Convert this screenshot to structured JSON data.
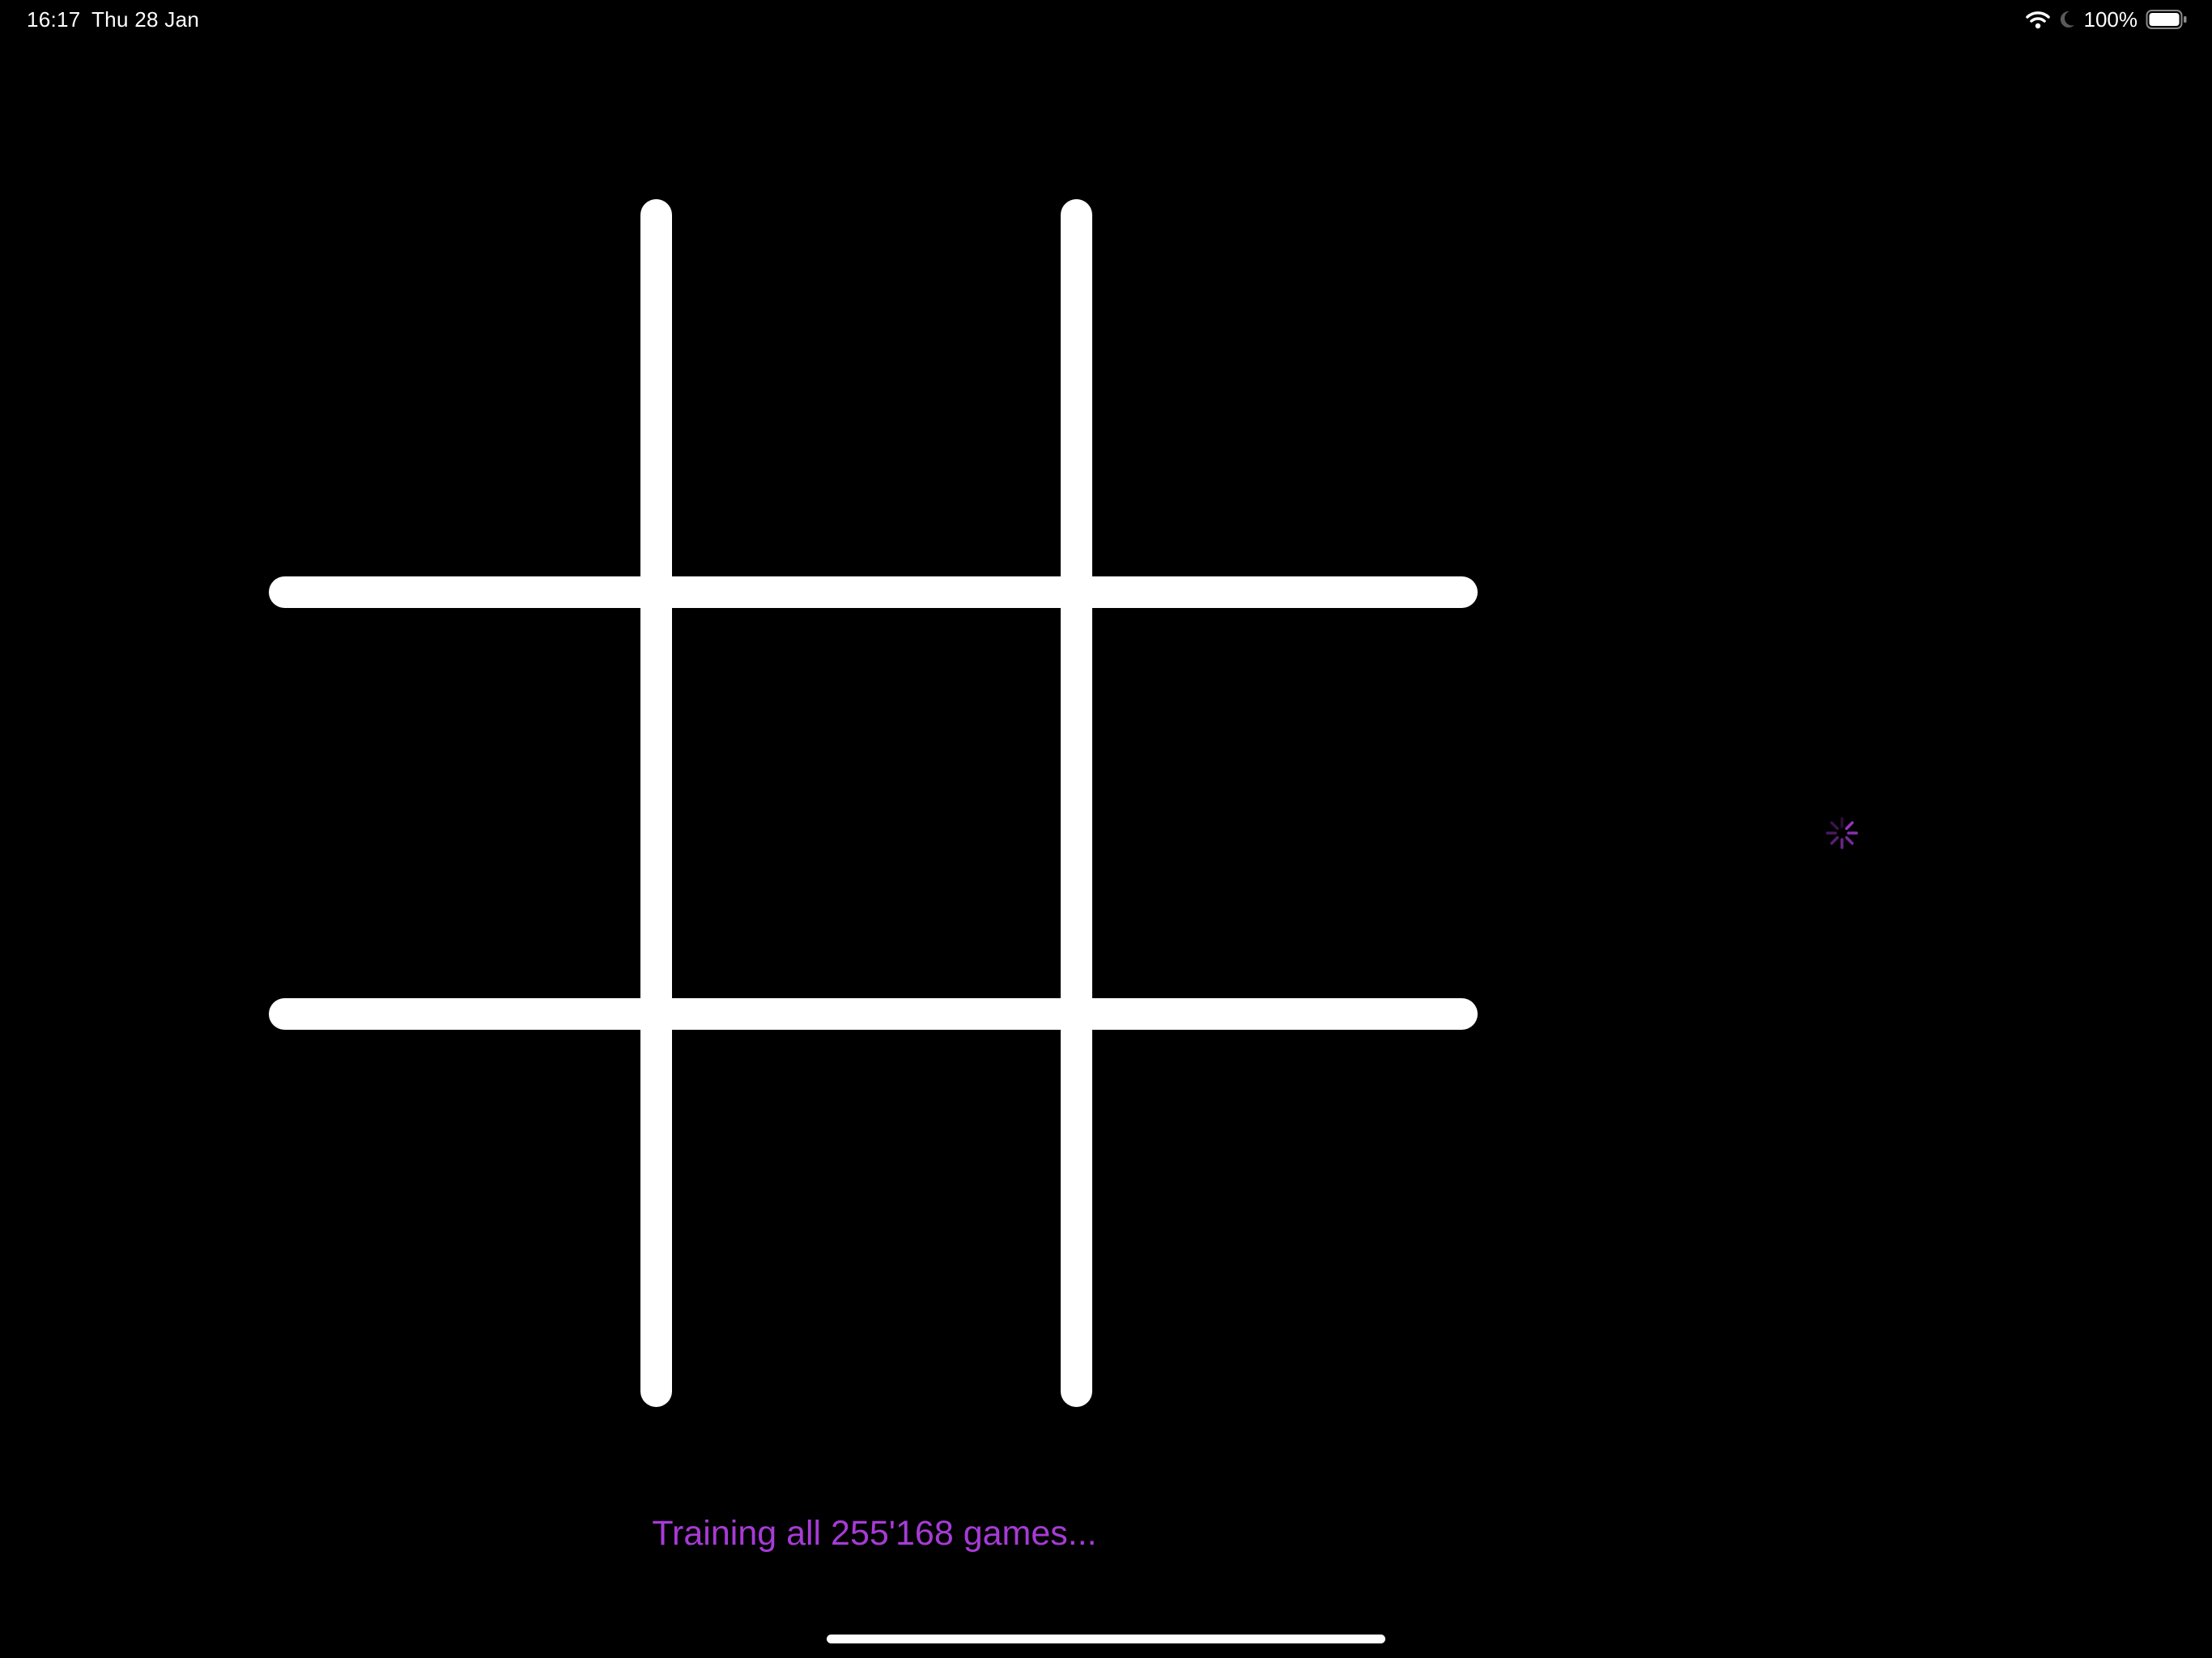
{
  "status_bar": {
    "time": "16:17",
    "date": "Thu 28 Jan",
    "battery_percent": "100%",
    "icons": [
      "wifi-icon",
      "moon-icon",
      "battery-icon"
    ]
  },
  "board": {
    "cells": [
      "",
      "",
      "",
      "",
      "",
      "",
      "",
      "",
      ""
    ],
    "line_color": "#ffffff"
  },
  "spinner": {
    "icon": "activity-spinner-icon",
    "color": "#a73bd6"
  },
  "training": {
    "message": "Training all 255'168 games...",
    "color": "#a73bd6"
  },
  "colors": {
    "background": "#000000",
    "accent": "#a73bd6"
  }
}
